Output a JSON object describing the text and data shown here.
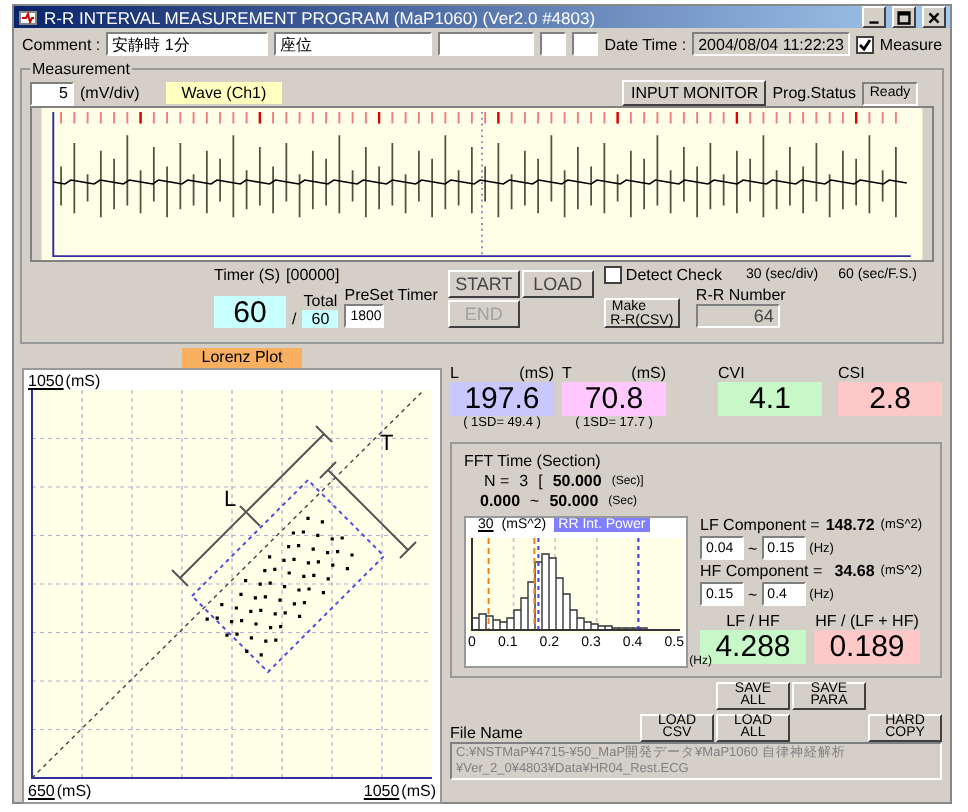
{
  "window": {
    "title": "R-R INTERVAL MEASUREMENT PROGRAM (MaP1060)  (Ver2.0 #4803)"
  },
  "comment": {
    "label": "Comment :",
    "fields": [
      {
        "value": "安静時 1分"
      },
      {
        "value": "座位"
      }
    ]
  },
  "date_time": {
    "label": "Date Time :",
    "value": "2004/08/04 11:22:23"
  },
  "measure": {
    "label": "Measure",
    "checked": true
  },
  "measurement": {
    "title": "Measurement",
    "scale": "5",
    "scale_unit": "(mV/div)",
    "wave_label": "Wave (Ch1)",
    "monitor_button": "INPUT MONITOR",
    "status_label": "Prog.Status",
    "status": "Ready"
  },
  "timer": {
    "label": "Timer (S)",
    "code": "[00000]",
    "value": "60",
    "slash": "/",
    "total_label": "Total",
    "total": "60",
    "preset_label": "PreSet Timer",
    "preset": "1800"
  },
  "control_buttons": [
    {
      "label": "START",
      "disabled": false
    },
    {
      "label": "LOAD",
      "disabled": false
    },
    {
      "label": "END",
      "disabled": true
    }
  ],
  "make_button": {
    "line1": "Make",
    "line2": "R-R(CSV)"
  },
  "detect_check": {
    "label": "Detect Check",
    "checked": false
  },
  "time_scale": {
    "div": "30 (sec/div)",
    "full": "60 (sec/F.S.)"
  },
  "rr_number": {
    "label": "R-R Number",
    "value": "64"
  },
  "lorenz": {
    "tab": "Lorenz Plot",
    "y_max": "1050",
    "y_unit": "(mS)",
    "x_min": "650",
    "x_min_unit": "(mS)",
    "x_max": "1050",
    "x_max_unit": "(mS)",
    "l_mark": "L",
    "t_mark": "T"
  },
  "metrics": [
    {
      "label": "L",
      "unit": "(mS)",
      "value": "197.6",
      "sd": "( 1SD= 49.4 )",
      "color": "#c8c8ff"
    },
    {
      "label": "T",
      "unit": "(mS)",
      "value": "70.8",
      "sd": "( 1SD= 17.7 )",
      "color": "#ffc8ff"
    },
    {
      "label": "CVI",
      "value": "4.1",
      "color": "#c8f8c8"
    },
    {
      "label": "CSI",
      "value": "2.8",
      "color": "#ffc8c8"
    }
  ],
  "fft": {
    "title": "FFT Time (Section)",
    "n_label": "N =",
    "n": "3",
    "open": "[",
    "section_len": "50.000",
    "section_unit": "(Sec)]",
    "from": "0.000",
    "tilde": "~",
    "to": "50.000",
    "to_unit": "(Sec)",
    "spectrum": {
      "y_max": "30",
      "y_unit": "(mS^2)",
      "legend": "RR Int. Power",
      "xticks": [
        "0",
        "0.1",
        "0.2",
        "0.3",
        "0.4",
        "0.5"
      ],
      "x_unit": "(Hz)"
    },
    "lf": {
      "label": "LF Component =",
      "value": "148.72",
      "unit": "(mS^2)",
      "from": "0.04",
      "tilde": "~",
      "to": "0.15",
      "range_unit": "(Hz)"
    },
    "hf": {
      "label": "HF Component =",
      "value": "34.68",
      "unit": "(mS^2)",
      "from": "0.15",
      "tilde": "~",
      "to": "0.4",
      "range_unit": "(Hz)"
    },
    "ratios": [
      {
        "label": "LF / HF",
        "value": "4.288",
        "color": "#c8f8c8"
      },
      {
        "label": "HF / (LF + HF)",
        "value": "0.189",
        "color": "#ffc8c8"
      }
    ]
  },
  "file_buttons": {
    "save_all": "SAVE ALL",
    "save_para": "SAVE PARA",
    "load_csv": "LOAD CSV",
    "load_all": "LOAD ALL",
    "hard_copy": "HARD COPY"
  },
  "file": {
    "label": "File Name",
    "path": "C:¥NSTMaP¥4715-¥50_MaP開発データ¥MaP1060 自律神経解析¥Ver_2_0¥4803¥Data¥HR04_Rest.ECG"
  }
}
